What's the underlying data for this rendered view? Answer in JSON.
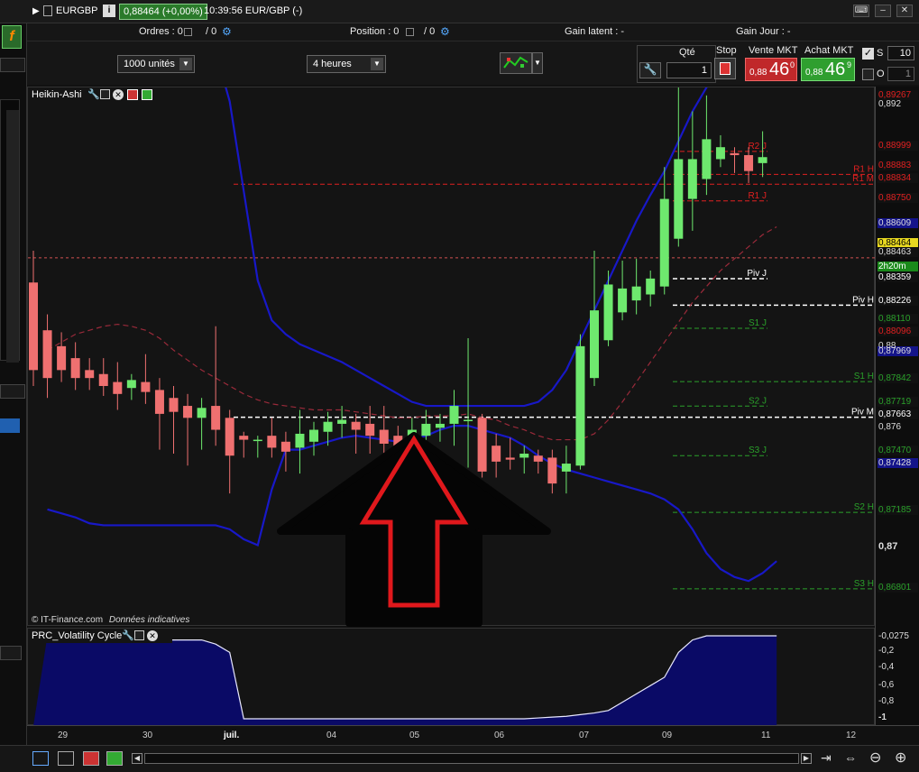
{
  "title": {
    "symbol": "EURGBP",
    "price": "0,88464 (+0,00%)",
    "time_pair": "10:39:56 EUR/GBP (-)"
  },
  "infobar": {
    "orders": "Ordres : 0",
    "orders_sep": "/ 0",
    "position": "Position : 0",
    "position_sep": "/ 0",
    "gain_latent": "Gain latent : -",
    "gain_jour": "Gain Jour : -"
  },
  "toolbar": {
    "units": "1000 unités",
    "period": "4 heures",
    "qty_label": "Qté",
    "qty_value": "1",
    "stop_label": "Stop",
    "sell_label": "Vente MKT",
    "sell_small": "0,88",
    "sell_big": "46",
    "sell_sup": "0",
    "buy_label": "Achat MKT",
    "buy_small": "0,88",
    "buy_big": "46",
    "buy_sup": "9",
    "s_label": "S",
    "s_value": "10",
    "o_label": "O",
    "o_value": "1"
  },
  "chart_header": "Heikin-Ashi",
  "watermark": "© IT-Finance.com",
  "watermark_note": "Données indicatives",
  "indicator_header": "PRC_Volatility Cycle",
  "colors": {
    "bull": "#6ee86e",
    "bear": "#ef7070",
    "band": "#1818c8",
    "arrow": "#e0181c"
  },
  "levels": [
    {
      "label": "R2 J",
      "value": 0.88999,
      "color": "#e02020",
      "x": 745,
      "x2": 850
    },
    {
      "label": "R1 H",
      "value": 0.88883,
      "color": "#e02020",
      "x": 745,
      "x2": 969
    },
    {
      "label": "R1 M",
      "value": 0.88834,
      "color": "#e02020",
      "x": 258,
      "x2": 969
    },
    {
      "label": "R1 J",
      "value": 0.8875,
      "color": "#e02020",
      "x": 745,
      "x2": 850
    },
    {
      "label": "Piv J",
      "value": 0.88359,
      "color": "#ffffff",
      "x": 745,
      "x2": 850
    },
    {
      "label": "Piv H",
      "value": 0.88226,
      "color": "#ffffff",
      "x": 745,
      "x2": 969
    },
    {
      "label": "S1 J",
      "value": 0.8811,
      "color": "#2aa02a",
      "x": 745,
      "x2": 850
    },
    {
      "label": "S1 H",
      "value": 0.87842,
      "color": "#2aa02a",
      "x": 745,
      "x2": 969
    },
    {
      "label": "S2 J",
      "value": 0.87719,
      "color": "#2aa02a",
      "x": 745,
      "x2": 850
    },
    {
      "label": "Piv M",
      "value": 0.87663,
      "color": "#ffffff",
      "x": 258,
      "x2": 969
    },
    {
      "label": "S3 J",
      "value": 0.8747,
      "color": "#2aa02a",
      "x": 745,
      "x2": 850
    },
    {
      "label": "S2 H",
      "value": 0.87185,
      "color": "#2aa02a",
      "x": 745,
      "x2": 969
    },
    {
      "label": "S3 H",
      "value": 0.86801,
      "color": "#2aa02a",
      "x": 745,
      "x2": 969
    }
  ],
  "axis": {
    "ticks": [
      "0,892",
      "0,876",
      "0,87",
      "0,88"
    ],
    "tags": [
      {
        "text": "0,89267",
        "bg": "#111",
        "fg": "#e02020"
      },
      {
        "text": "0,88999",
        "bg": "#111",
        "fg": "#e02020"
      },
      {
        "text": "0,88883",
        "bg": "#111",
        "fg": "#e02020"
      },
      {
        "text": "0,88834",
        "bg": "#111",
        "fg": "#e02020"
      },
      {
        "text": "0,88750",
        "bg": "#111",
        "fg": "#e02020"
      },
      {
        "text": "0,88609",
        "bg": "#14148a",
        "fg": "#ddd"
      },
      {
        "text": "0,88464",
        "bg": "#e8d820",
        "fg": "#000"
      },
      {
        "text": "0,88463",
        "bg": "#111",
        "fg": "#ddd"
      },
      {
        "text": "2h20m",
        "bg": "#1a8a1a",
        "fg": "#fff"
      },
      {
        "text": "0,88359",
        "bg": "#111",
        "fg": "#fff"
      },
      {
        "text": "0,88226",
        "bg": "#111",
        "fg": "#fff"
      },
      {
        "text": "0,88110",
        "bg": "#111",
        "fg": "#2aa02a"
      },
      {
        "text": "0,88096",
        "bg": "#111",
        "fg": "#e02020"
      },
      {
        "text": "0,87969",
        "bg": "#14148a",
        "fg": "#ddd"
      },
      {
        "text": "0,87842",
        "bg": "#111",
        "fg": "#2aa02a"
      },
      {
        "text": "0,87719",
        "bg": "#111",
        "fg": "#2aa02a"
      },
      {
        "text": "0,87663",
        "bg": "#111",
        "fg": "#fff"
      },
      {
        "text": "0,87470",
        "bg": "#111",
        "fg": "#2aa02a"
      },
      {
        "text": "0,87428",
        "bg": "#14148a",
        "fg": "#ddd"
      },
      {
        "text": "0,87185",
        "bg": "#111",
        "fg": "#2aa02a"
      },
      {
        "text": "0,86801",
        "bg": "#111",
        "fg": "#2aa02a"
      }
    ],
    "ind_ticks": [
      "-0,0275",
      "-0,2",
      "-0,4",
      "-0,6",
      "-0,8",
      "-1"
    ]
  },
  "time_labels": [
    "29",
    "30",
    "juil.",
    "04",
    "05",
    "06",
    "07",
    "09",
    "11",
    "12"
  ],
  "chart_data": {
    "type": "candlestick",
    "title": "",
    "note": "Heikin-Ashi candles, EUR/GBP, 4 heures",
    "candles": [
      {
        "o": 0.8834,
        "c": 0.879,
        "h": 0.885,
        "l": 0.8782
      },
      {
        "o": 0.881,
        "c": 0.8786,
        "h": 0.8818,
        "l": 0.8776
      },
      {
        "o": 0.8802,
        "c": 0.879,
        "h": 0.8809,
        "l": 0.8784
      },
      {
        "o": 0.8796,
        "c": 0.8786,
        "h": 0.8804,
        "l": 0.878
      },
      {
        "o": 0.879,
        "c": 0.8786,
        "h": 0.8796,
        "l": 0.878
      },
      {
        "o": 0.8788,
        "c": 0.8782,
        "h": 0.8796,
        "l": 0.8777
      },
      {
        "o": 0.8784,
        "c": 0.8778,
        "h": 0.8794,
        "l": 0.877
      },
      {
        "o": 0.8781,
        "c": 0.8785,
        "h": 0.8788,
        "l": 0.8775
      },
      {
        "o": 0.8784,
        "c": 0.8779,
        "h": 0.8798,
        "l": 0.8773
      },
      {
        "o": 0.878,
        "c": 0.8768,
        "h": 0.8786,
        "l": 0.875
      },
      {
        "o": 0.8776,
        "c": 0.8769,
        "h": 0.8782,
        "l": 0.8748
      },
      {
        "o": 0.8772,
        "c": 0.8766,
        "h": 0.8778,
        "l": 0.8742
      },
      {
        "o": 0.8766,
        "c": 0.8771,
        "h": 0.8776,
        "l": 0.875
      },
      {
        "o": 0.8772,
        "c": 0.876,
        "h": 0.8812,
        "l": 0.8752
      },
      {
        "o": 0.8766,
        "c": 0.8747,
        "h": 0.877,
        "l": 0.8728
      },
      {
        "o": 0.8757,
        "c": 0.8755,
        "h": 0.8759,
        "l": 0.8746
      },
      {
        "o": 0.8755,
        "c": 0.8755,
        "h": 0.8757,
        "l": 0.8746
      },
      {
        "o": 0.8757,
        "c": 0.8751,
        "h": 0.8766,
        "l": 0.8746
      },
      {
        "o": 0.8754,
        "c": 0.8749,
        "h": 0.8759,
        "l": 0.8739
      },
      {
        "o": 0.8751,
        "c": 0.8758,
        "h": 0.877,
        "l": 0.8738
      },
      {
        "o": 0.8754,
        "c": 0.876,
        "h": 0.8764,
        "l": 0.8747
      },
      {
        "o": 0.8759,
        "c": 0.8764,
        "h": 0.8769,
        "l": 0.8752
      },
      {
        "o": 0.8763,
        "c": 0.8765,
        "h": 0.8772,
        "l": 0.8756
      },
      {
        "o": 0.8764,
        "c": 0.876,
        "h": 0.8768,
        "l": 0.8748
      },
      {
        "o": 0.8763,
        "c": 0.8757,
        "h": 0.8772,
        "l": 0.8748
      },
      {
        "o": 0.876,
        "c": 0.8753,
        "h": 0.8772,
        "l": 0.8744
      },
      {
        "o": 0.8757,
        "c": 0.875,
        "h": 0.8762,
        "l": 0.8744
      },
      {
        "o": 0.8753,
        "c": 0.876,
        "h": 0.8766,
        "l": 0.8746
      },
      {
        "o": 0.8757,
        "c": 0.8763,
        "h": 0.877,
        "l": 0.875
      },
      {
        "o": 0.8761,
        "c": 0.8763,
        "h": 0.8768,
        "l": 0.8754
      },
      {
        "o": 0.8763,
        "c": 0.8772,
        "h": 0.878,
        "l": 0.8752
      },
      {
        "o": 0.8765,
        "c": 0.8765,
        "h": 0.8806,
        "l": 0.8741
      },
      {
        "o": 0.8766,
        "c": 0.8739,
        "h": 0.8768,
        "l": 0.8736
      },
      {
        "o": 0.8752,
        "c": 0.8744,
        "h": 0.8758,
        "l": 0.8736
      },
      {
        "o": 0.8746,
        "c": 0.8745,
        "h": 0.8756,
        "l": 0.874
      },
      {
        "o": 0.8746,
        "c": 0.8748,
        "h": 0.8752,
        "l": 0.8738
      },
      {
        "o": 0.8747,
        "c": 0.8744,
        "h": 0.875,
        "l": 0.8738
      },
      {
        "o": 0.8746,
        "c": 0.8733,
        "h": 0.875,
        "l": 0.8728
      },
      {
        "o": 0.8739,
        "c": 0.8743,
        "h": 0.8752,
        "l": 0.8728
      },
      {
        "o": 0.8742,
        "c": 0.8802,
        "h": 0.8808,
        "l": 0.874
      },
      {
        "o": 0.8786,
        "c": 0.882,
        "h": 0.885,
        "l": 0.8782
      },
      {
        "o": 0.8805,
        "c": 0.8833,
        "h": 0.884,
        "l": 0.8802
      },
      {
        "o": 0.8819,
        "c": 0.8831,
        "h": 0.8845,
        "l": 0.8815
      },
      {
        "o": 0.8825,
        "c": 0.8832,
        "h": 0.8846,
        "l": 0.8818
      },
      {
        "o": 0.8828,
        "c": 0.8836,
        "h": 0.884,
        "l": 0.8822
      },
      {
        "o": 0.8832,
        "c": 0.8876,
        "h": 0.8892,
        "l": 0.8828
      },
      {
        "o": 0.8856,
        "c": 0.8896,
        "h": 0.894,
        "l": 0.8852
      },
      {
        "o": 0.8876,
        "c": 0.8896,
        "h": 0.892,
        "l": 0.886
      },
      {
        "o": 0.8886,
        "c": 0.8906,
        "h": 0.8928,
        "l": 0.8878
      },
      {
        "o": 0.8896,
        "c": 0.8902,
        "h": 0.8908,
        "l": 0.8892
      },
      {
        "o": 0.8899,
        "c": 0.8898,
        "h": 0.8902,
        "l": 0.8889
      },
      {
        "o": 0.8898,
        "c": 0.889,
        "h": 0.8902,
        "l": 0.8884
      },
      {
        "o": 0.8894,
        "c": 0.8897,
        "h": 0.891,
        "l": 0.8887
      }
    ],
    "upper_band": [
      0.896,
      0.896,
      0.896,
      0.896,
      0.896,
      0.896,
      0.896,
      0.896,
      0.896,
      0.896,
      0.896,
      0.8958,
      0.895,
      0.8925,
      0.888,
      0.8835,
      0.8815,
      0.8808,
      0.8803,
      0.88,
      0.8797,
      0.8794,
      0.879,
      0.8786,
      0.8782,
      0.8778,
      0.8774,
      0.8772,
      0.8772,
      0.8772,
      0.8772,
      0.8772,
      0.8772,
      0.8772,
      0.8772,
      0.8774,
      0.878,
      0.879,
      0.8805,
      0.882,
      0.8835,
      0.885,
      0.8865,
      0.8878,
      0.889,
      0.8905,
      0.892,
      0.8932,
      0.8944,
      0.8953,
      0.8962,
      0.897,
      0.8976
    ],
    "lower_band": [
      0.872,
      0.8718,
      0.8716,
      0.8713,
      0.8712,
      0.8712,
      0.8712,
      0.8712,
      0.8712,
      0.8712,
      0.8712,
      0.8712,
      0.8712,
      0.871,
      0.8705,
      0.8702,
      0.873,
      0.875,
      0.875,
      0.8752,
      0.8754,
      0.8756,
      0.8757,
      0.8756,
      0.8755,
      0.8754,
      0.8755,
      0.8757,
      0.876,
      0.8762,
      0.8762,
      0.876,
      0.8758,
      0.8756,
      0.8752,
      0.8747,
      0.8743,
      0.874,
      0.8738,
      0.8736,
      0.8734,
      0.8732,
      0.873,
      0.8728,
      0.8725,
      0.872,
      0.871,
      0.8698,
      0.869,
      0.8686,
      0.8684,
      0.8688,
      0.8694
    ],
    "middle": [
      0.88,
      0.8804,
      0.8808,
      0.881,
      0.8812,
      0.8813,
      0.8812,
      0.881,
      0.8806,
      0.88,
      0.8795,
      0.879,
      0.8786,
      0.8782,
      0.8778,
      0.8775,
      0.8773,
      0.8772,
      0.8771,
      0.877,
      0.877,
      0.877,
      0.8769,
      0.8768,
      0.8767,
      0.8766,
      0.8766,
      0.8767,
      0.8767,
      0.8767,
      0.8768,
      0.8766,
      0.8765,
      0.8762,
      0.876,
      0.8757,
      0.8755,
      0.8755,
      0.8755,
      0.8758,
      0.8765,
      0.8774,
      0.8784,
      0.8794,
      0.8804,
      0.8814,
      0.8824,
      0.8832,
      0.884,
      0.8846,
      0.8852,
      0.8858,
      0.8862
    ],
    "ylim": [
      0.8661,
      0.8932
    ],
    "arrow": "up",
    "volatility_cycle": [
      0,
      0,
      -0.02,
      -0.03,
      -0.04,
      -0.05,
      -0.05,
      -0.05,
      -0.05,
      -0.05,
      -0.05,
      -0.05,
      -0.1,
      -0.2,
      -1,
      -1,
      -1,
      -1,
      -1,
      -1,
      -1,
      -1,
      -1,
      -1,
      -1,
      -1,
      -1,
      -1,
      -1,
      -1,
      -1,
      -1,
      -1,
      -1,
      -1,
      -0.99,
      -0.98,
      -0.97,
      -0.95,
      -0.93,
      -0.9,
      -0.8,
      -0.7,
      -0.6,
      -0.5,
      -0.2,
      -0.05,
      0,
      0,
      0,
      0,
      0,
      0
    ]
  }
}
